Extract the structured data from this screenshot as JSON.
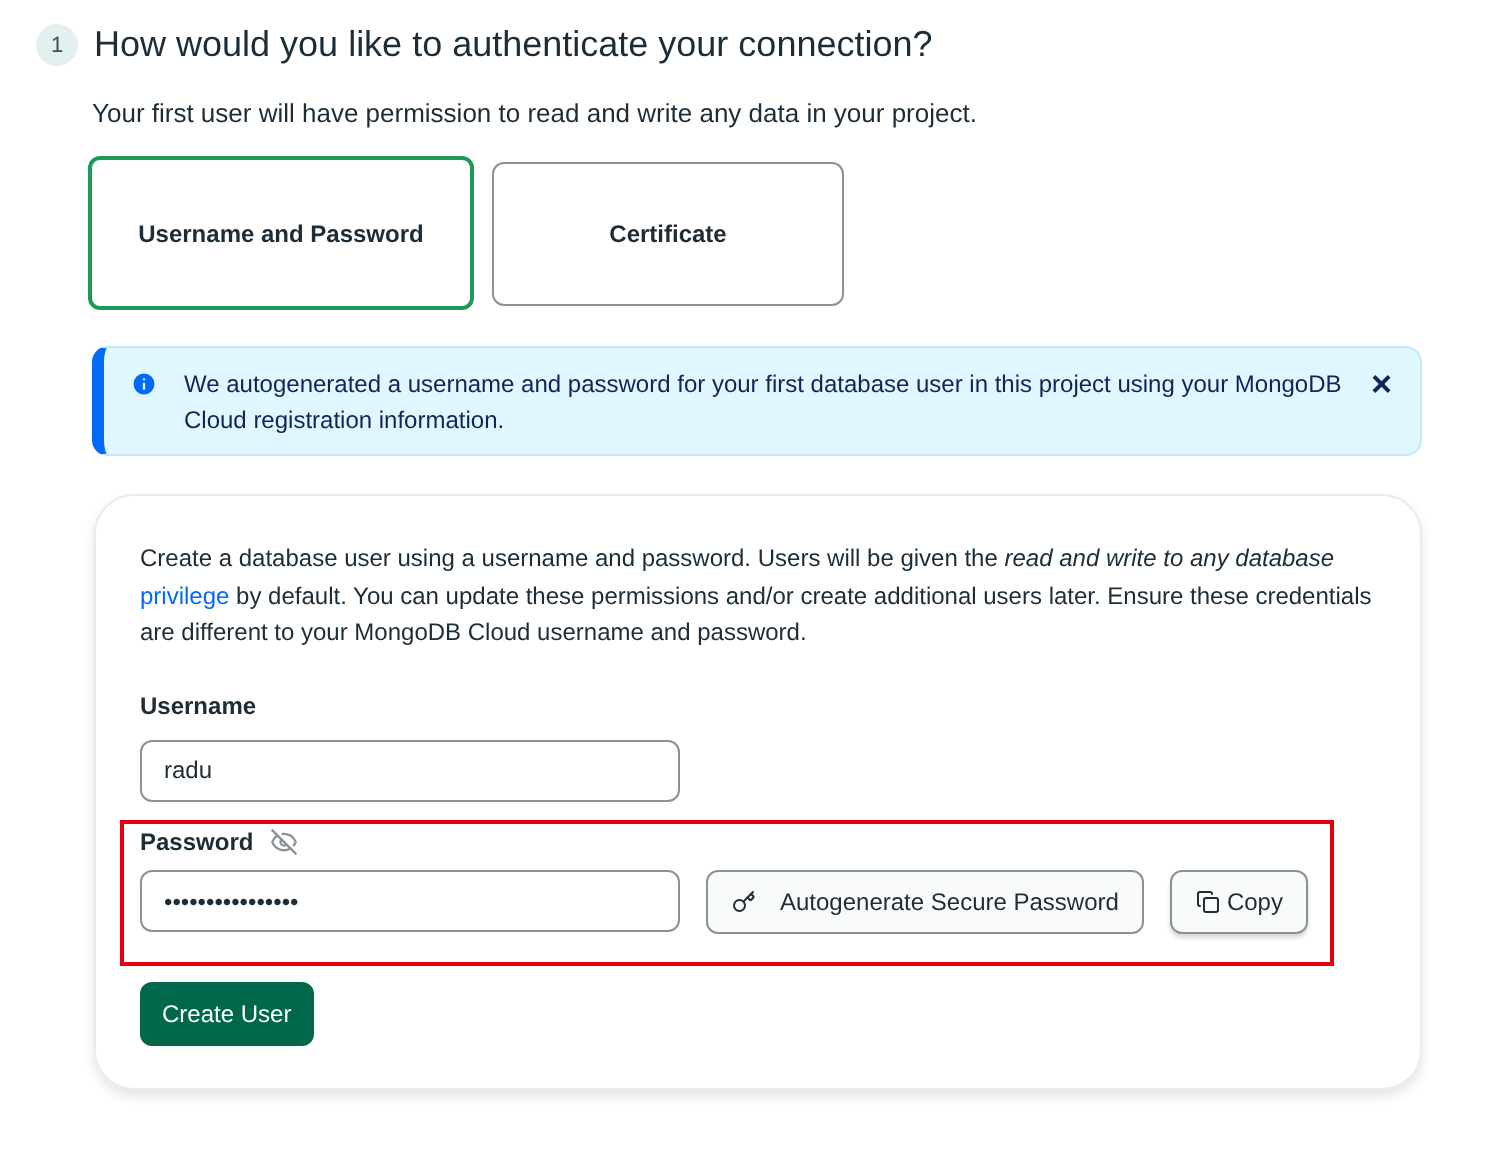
{
  "step": {
    "number": "1",
    "title": "How would you like to authenticate your connection?"
  },
  "subtitle": "Your first user will have permission to read and write any data in your project.",
  "auth_options": [
    {
      "label": "Username and Password",
      "selected": true
    },
    {
      "label": "Certificate",
      "selected": false
    }
  ],
  "alert": {
    "text": "We autogenerated a username and password for your first database user in this project using your MongoDB Cloud registration information.",
    "close": "×"
  },
  "form": {
    "description": {
      "before": "Create a database user using a username and password. Users will be given the *read and write to any database*",
      "link": "privilege",
      "after": "by default. You can update these permissions and/or create additional users later. Ensure these credentials are different to your MongoDB Cloud username and password."
    },
    "username": {
      "label": "Username",
      "value": "radu"
    },
    "password": {
      "label": "Password",
      "value": "••••••••••••••••",
      "visible": false
    },
    "autogenerate_button": "Autogenerate Secure Password",
    "copy_button": "Copy",
    "submit_button": "Create User"
  }
}
